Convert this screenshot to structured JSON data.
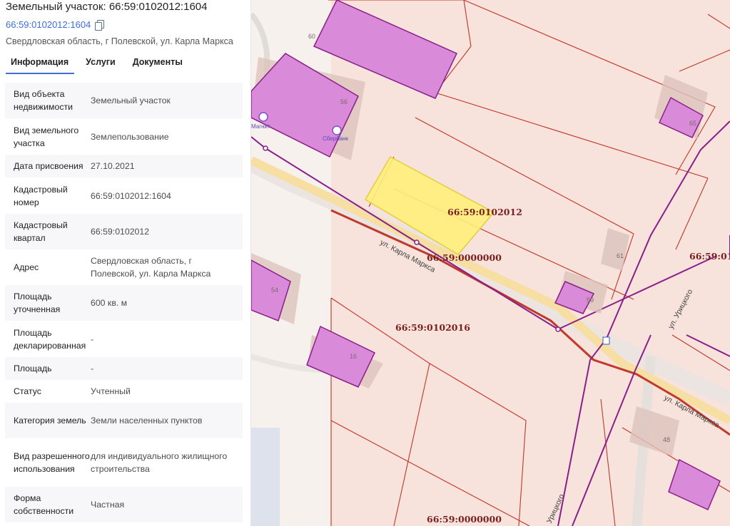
{
  "header": {
    "title": "Земельный участок: 66:59:0102012:1604",
    "cad_link": "66:59:0102012:1604",
    "address": "Свердловская область, г Полевской, ул. Карла Маркса"
  },
  "tabs": [
    {
      "label": "Информация",
      "active": true
    },
    {
      "label": "Услуги",
      "active": false
    },
    {
      "label": "Документы",
      "active": false
    }
  ],
  "info": [
    {
      "label": "Вид объекта недвижимости",
      "value": "Земельный участок"
    },
    {
      "label": "Вид земельного участка",
      "value": "Землепользование"
    },
    {
      "label": "Дата присвоения",
      "value": "27.10.2021"
    },
    {
      "label": "Кадастровый номер",
      "value": "66:59:0102012:1604"
    },
    {
      "label": "Кадастровый квартал",
      "value": "66:59:0102012"
    },
    {
      "label": "Адрес",
      "value": "Свердловская область, г Полевской, ул. Карла Маркса"
    },
    {
      "label": "Площадь уточненная",
      "value": "600 кв. м"
    },
    {
      "label": "Площадь декларированная",
      "value": "-"
    },
    {
      "label": "Площадь",
      "value": "-"
    },
    {
      "label": "Статус",
      "value": "Учтенный"
    },
    {
      "label": "Категория земель",
      "value": "Земли населенных пунктов"
    },
    {
      "label": "Вид разрешенного использования",
      "value": "для индивидуального жилищного строительства"
    },
    {
      "label": "Форма собственности",
      "value": "Частная"
    }
  ],
  "map": {
    "quarter_labels": {
      "main": "66:59:0102012",
      "road": "66:59:0000000",
      "south": "66:59:0102016",
      "east": "66:59:01",
      "bottom": "66:59:0000000"
    },
    "streets": {
      "karla_marksa_1": "ул. Карла Маркса",
      "karla_marksa_2": "ул. Карла Маркса",
      "uritskogo": "ул. Урицкого",
      "uritskogo_2": "Урицкого"
    },
    "buildings": {
      "b60": "60",
      "b56": "56",
      "b65": "65",
      "b61": "61",
      "b54": "54",
      "b59": "59",
      "b16": "16",
      "b48": "48"
    },
    "pois": {
      "magnit": "Магнит",
      "sberbank": "Сбербанк"
    },
    "colors": {
      "parcel_highlight": "#fff07a",
      "building_fill": "#d98ad8",
      "parcel_border": "#c2352a",
      "boundary_purple": "#8a1f8a"
    }
  }
}
